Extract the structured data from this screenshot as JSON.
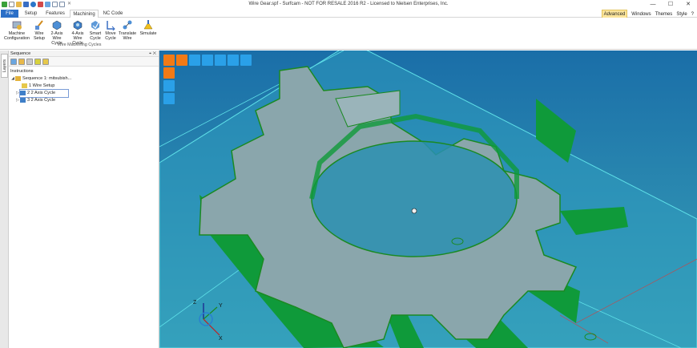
{
  "window": {
    "title": "Wire Gear.spf - Surfcam - NOT FOR RESALE 2016 R2 - Licensed to Nielsen Enterprises, Inc.",
    "min_glyph": "—",
    "max_glyph": "☐",
    "close_glyph": "✕"
  },
  "tabs": [
    {
      "label": "File"
    },
    {
      "label": "Setup"
    },
    {
      "label": "Features"
    },
    {
      "label": "Machining"
    },
    {
      "label": "NC Code"
    }
  ],
  "right_menu": {
    "advanced": "Advanced",
    "windows": "Windows",
    "themes": "Themes",
    "style": "Style",
    "help": "?"
  },
  "ribbon": {
    "buttons": [
      {
        "line1": "Machine",
        "line2": "Configuration",
        "icon": "machine-config-icon"
      },
      {
        "line1": "Wire",
        "line2": "Setup",
        "icon": "wire-setup-icon"
      },
      {
        "line1": "2-Axis",
        "line2": "Wire Cycle",
        "icon": "two-axis-wire-icon"
      },
      {
        "line1": "4-Axis",
        "line2": "Wire Cycle",
        "icon": "four-axis-wire-icon"
      },
      {
        "line1": "Smart",
        "line2": "Cycle",
        "icon": "smart-cycle-icon"
      },
      {
        "line1": "Move",
        "line2": "Cycle",
        "icon": "move-cycle-icon"
      },
      {
        "line1": "Translate",
        "line2": "Wire",
        "icon": "translate-wire-icon"
      },
      {
        "line1": "Simulate",
        "line2": "",
        "icon": "simulate-icon"
      }
    ],
    "group_label": "Wire Machining Cycles"
  },
  "left_strip": {
    "layers_label": "Layers"
  },
  "panel": {
    "title": "Sequence",
    "pin": "⌖",
    "close": "✕",
    "tree": [
      {
        "label": "Instructions",
        "level": 0
      },
      {
        "label": "Sequence 1: mitsubish...",
        "level": 1
      },
      {
        "label": "1 Wire Setup",
        "level": 2
      },
      {
        "label": "2 2 Axis Cycle",
        "level": 2
      },
      {
        "label": "3 2 Axis Cycle",
        "level": 2
      }
    ]
  },
  "viewport": {
    "axes": {
      "x": "X",
      "y": "Y",
      "z": "Z"
    }
  },
  "colors": {
    "file_tab": "#2b6fc7",
    "viewport_bg": "#1f8fb0",
    "gear_top": "#8aa6ac",
    "gear_edge": "#1a8a22",
    "wall_green": "#0f9a3a",
    "plane_cyan": "#37c8d8",
    "tool_orange": "#f27a16",
    "tool_blue": "#2aa0e8"
  }
}
